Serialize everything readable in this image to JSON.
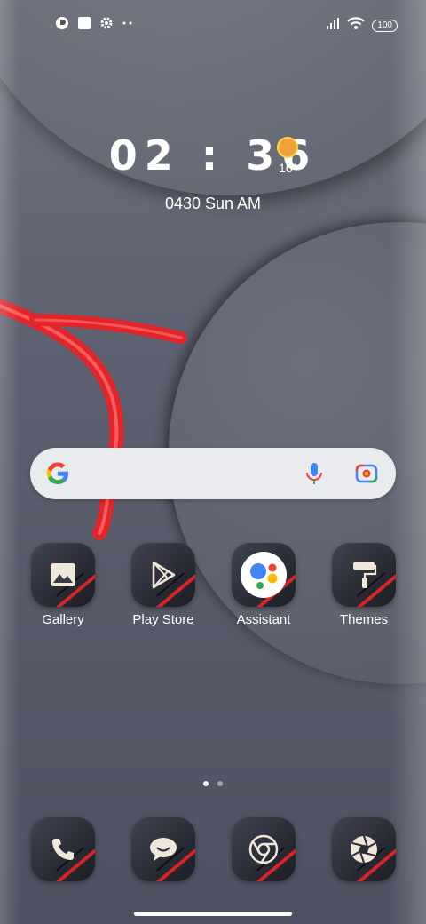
{
  "status": {
    "battery": "100",
    "left_icons": [
      "app-notification-icon",
      "square-notification-icon",
      "gear-icon",
      "more-dots-icon"
    ],
    "right_icons": [
      "signal-icon",
      "wifi-icon",
      "battery-icon"
    ]
  },
  "clock": {
    "time": "02 : 36",
    "temp": "16°",
    "date": "0430 Sun AM"
  },
  "search": {
    "icons": [
      "google-g-icon",
      "mic-icon",
      "lens-icon"
    ]
  },
  "apps": [
    {
      "label": "Gallery",
      "icon": "gallery-icon"
    },
    {
      "label": "Play Store",
      "icon": "play-store-icon"
    },
    {
      "label": "Assistant",
      "icon": "assistant-icon"
    },
    {
      "label": "Themes",
      "icon": "themes-icon"
    }
  ],
  "page_indicator": {
    "pages": 2,
    "current": 1
  },
  "dock": [
    {
      "icon": "phone-icon"
    },
    {
      "icon": "messages-icon"
    },
    {
      "icon": "chrome-icon"
    },
    {
      "icon": "camera-icon"
    }
  ],
  "colors": {
    "accent_red": "#d62528",
    "sun": "#f0a23a"
  }
}
